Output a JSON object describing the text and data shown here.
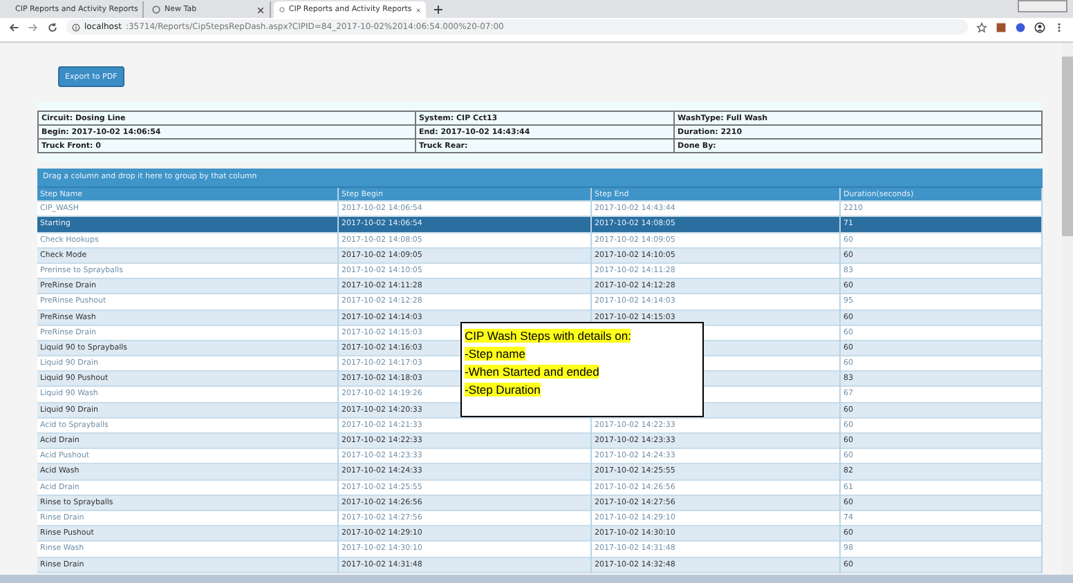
{
  "browser": {
    "tabs": [
      {
        "title": "CIP Reports and Activity Reports",
        "selected": false
      },
      {
        "title": "New Tab",
        "selected": false
      },
      {
        "title": "CIP Reports and Activity Reports",
        "selected": true
      }
    ],
    "url_host": "localhost",
    "url_rest": ":35714/Reports/CipStepsRepDash.aspx?CIPID=84_2017-10-02%2014:06:54.000%20-07:00"
  },
  "export_button": "Export to PDF",
  "info": [
    [
      "Circuit: Dosing Line",
      "System: CIP Cct13",
      "WashType: Full Wash"
    ],
    [
      "Begin: 2017-10-02 14:06:54",
      "End: 2017-10-02 14:43:44",
      "Duration: 2210"
    ],
    [
      "Truck Front: 0",
      "Truck Rear:",
      "Done By:"
    ]
  ],
  "group_hint": "Drag a column and drop it here to group by that column",
  "table": {
    "columns": [
      "Step Name",
      "Step Begin",
      "Step End",
      "Duration(seconds)"
    ],
    "rows": [
      {
        "name": "CIP_WASH",
        "begin": "2017-10-02 14:06:54",
        "end": "2017-10-02 14:43:44",
        "duration": "2210",
        "selected": false
      },
      {
        "name": "Starting",
        "begin": "2017-10-02 14:06:54",
        "end": "2017-10-02 14:08:05",
        "duration": "71",
        "selected": true
      },
      {
        "name": "Check Hookups",
        "begin": "2017-10-02 14:08:05",
        "end": "2017-10-02 14:09:05",
        "duration": "60",
        "selected": false
      },
      {
        "name": "Check Mode",
        "begin": "2017-10-02 14:09:05",
        "end": "2017-10-02 14:10:05",
        "duration": "60",
        "selected": false
      },
      {
        "name": "Prerinse to Sprayballs",
        "begin": "2017-10-02 14:10:05",
        "end": "2017-10-02 14:11:28",
        "duration": "83",
        "selected": false
      },
      {
        "name": "PreRinse Drain",
        "begin": "2017-10-02 14:11:28",
        "end": "2017-10-02 14:12:28",
        "duration": "60",
        "selected": false
      },
      {
        "name": "PreRinse Pushout",
        "begin": "2017-10-02 14:12:28",
        "end": "2017-10-02 14:14:03",
        "duration": "95",
        "selected": false
      },
      {
        "name": "PreRinse Wash",
        "begin": "2017-10-02 14:14:03",
        "end": "2017-10-02 14:15:03",
        "duration": "60",
        "selected": false
      },
      {
        "name": "PreRinse Drain",
        "begin": "2017-10-02 14:15:03",
        "duration": "60",
        "selected": false
      },
      {
        "name": "Liquid 90 to Sprayballs",
        "begin": "2017-10-02 14:16:03",
        "duration": "60",
        "selected": false
      },
      {
        "name": "Liquid 90 Drain",
        "begin": "2017-10-02 14:17:03",
        "duration": "60",
        "selected": false
      },
      {
        "name": "Liquid 90 Pushout",
        "begin": "2017-10-02 14:18:03",
        "duration": "83",
        "selected": false
      },
      {
        "name": "Liquid 90 Wash",
        "begin": "2017-10-02 14:19:26",
        "duration": "67",
        "selected": false
      },
      {
        "name": "Liquid 90 Drain",
        "begin": "2017-10-02 14:20:33",
        "duration": "60",
        "selected": false
      },
      {
        "name": "Acid to Sprayballs",
        "begin": "2017-10-02 14:21:33",
        "end": "2017-10-02 14:22:33",
        "duration": "60",
        "selected": false
      },
      {
        "name": "Acid Drain",
        "begin": "2017-10-02 14:22:33",
        "end": "2017-10-02 14:23:33",
        "duration": "60",
        "selected": false
      },
      {
        "name": "Acid Pushout",
        "begin": "2017-10-02 14:23:33",
        "end": "2017-10-02 14:24:33",
        "duration": "60",
        "selected": false
      },
      {
        "name": "Acid Wash",
        "begin": "2017-10-02 14:24:33",
        "end": "2017-10-02 14:25:55",
        "duration": "82",
        "selected": false
      },
      {
        "name": "Acid Drain",
        "begin": "2017-10-02 14:25:55",
        "end": "2017-10-02 14:26:56",
        "duration": "61",
        "selected": false
      },
      {
        "name": "Rinse to Sprayballs",
        "begin": "2017-10-02 14:26:56",
        "end": "2017-10-02 14:27:56",
        "duration": "60",
        "selected": false
      },
      {
        "name": "Rinse Drain",
        "begin": "2017-10-02 14:27:56",
        "end": "2017-10-02 14:29:10",
        "duration": "74",
        "selected": false
      },
      {
        "name": "Rinse Pushout",
        "begin": "2017-10-02 14:29:10",
        "end": "2017-10-02 14:30:10",
        "duration": "60",
        "selected": false
      },
      {
        "name": "Rinse Wash",
        "begin": "2017-10-02 14:30:10",
        "end": "2017-10-02 14:31:48",
        "duration": "98",
        "selected": false
      },
      {
        "name": "Rinse Drain",
        "begin": "2017-10-02 14:31:48",
        "end": "2017-10-02 14:32:48",
        "duration": "60",
        "selected": false
      }
    ]
  },
  "callout": [
    "CIP Wash Steps with details on:",
    "-Step name",
    "-When Started and ended",
    "-Step Duration"
  ]
}
